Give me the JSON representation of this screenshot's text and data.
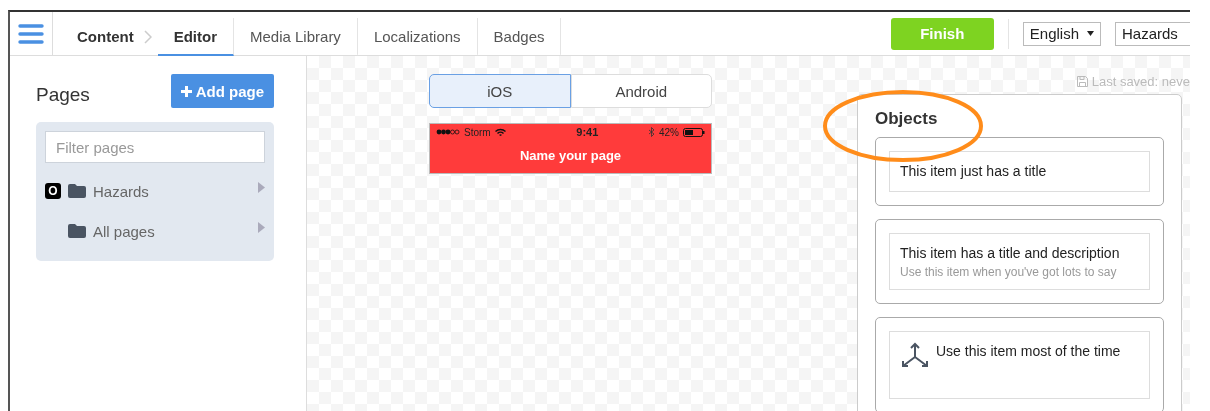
{
  "nav": {
    "tabs": [
      {
        "label": "Content",
        "selected": false,
        "kind": "crumb"
      },
      {
        "label": "Editor",
        "selected": true,
        "kind": "tab"
      },
      {
        "label": "Media Library",
        "selected": false,
        "kind": "tab"
      },
      {
        "label": "Localizations",
        "selected": false,
        "kind": "tab"
      },
      {
        "label": "Badges",
        "selected": false,
        "kind": "tab"
      }
    ],
    "finish_button": "Finish",
    "language_select": "English",
    "dropdown_value": "Hazards"
  },
  "pages_panel": {
    "title": "Pages",
    "add_button": "Add page",
    "filter": {
      "placeholder": "Filter pages"
    },
    "folders": [
      {
        "label": "Hazards",
        "badge": "O"
      },
      {
        "label": "All pages"
      }
    ]
  },
  "preview": {
    "platforms": [
      {
        "label": "iOS",
        "selected": true
      },
      {
        "label": "Android",
        "selected": false
      }
    ],
    "status_bar": {
      "carrier": "Storm",
      "time": "9:41",
      "battery": "42%"
    },
    "page_title": "Name your page"
  },
  "last_saved": "Last saved: neve",
  "objects": {
    "title": "Objects",
    "items": [
      {
        "kind": "title",
        "title": "This item just has a title"
      },
      {
        "kind": "title_description",
        "title": "This item has a title and description",
        "description": "Use this item when you've got lots to say"
      },
      {
        "kind": "icon_title",
        "title": "Use this item most of the time"
      }
    ]
  }
}
